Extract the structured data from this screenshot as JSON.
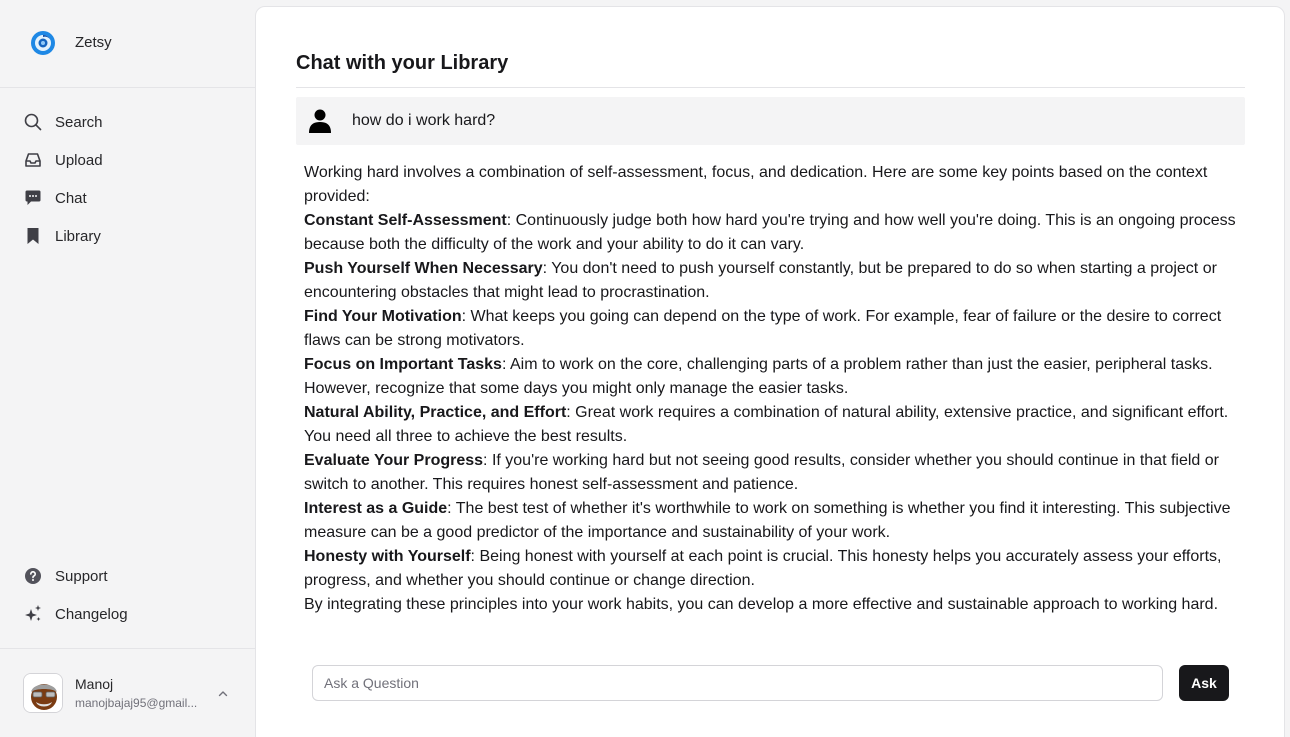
{
  "app": {
    "name": "Zetsy"
  },
  "sidebar": {
    "items": [
      {
        "label": "Search",
        "icon": "search-icon"
      },
      {
        "label": "Upload",
        "icon": "inbox-icon"
      },
      {
        "label": "Chat",
        "icon": "chat-bubble-icon"
      },
      {
        "label": "Library",
        "icon": "bookmark-icon"
      }
    ],
    "bottom_items": [
      {
        "label": "Support",
        "icon": "help-circle-icon"
      },
      {
        "label": "Changelog",
        "icon": "sparkles-icon"
      }
    ],
    "user": {
      "name": "Manoj",
      "email": "manojbajaj95@gmail..."
    }
  },
  "main": {
    "title": "Chat with your Library",
    "question": "how do i work hard?",
    "answer": {
      "intro": "Working hard involves a combination of self-assessment, focus, and dedication. Here are some key points based on the context provided:",
      "points": [
        {
          "title": "Constant Self-Assessment",
          "text": ": Continuously judge both how hard you're trying and how well you're doing. This is an ongoing process because both the difficulty of the work and your ability to do it can vary."
        },
        {
          "title": "Push Yourself When Necessary",
          "text": ": You don't need to push yourself constantly, but be prepared to do so when starting a project or encountering obstacles that might lead to procrastination."
        },
        {
          "title": "Find Your Motivation",
          "text": ": What keeps you going can depend on the type of work. For example, fear of failure or the desire to correct flaws can be strong motivators."
        },
        {
          "title": "Focus on Important Tasks",
          "text": ": Aim to work on the core, challenging parts of a problem rather than just the easier, peripheral tasks. However, recognize that some days you might only manage the easier tasks."
        },
        {
          "title": "Natural Ability, Practice, and Effort",
          "text": ": Great work requires a combination of natural ability, extensive practice, and significant effort. You need all three to achieve the best results."
        },
        {
          "title": "Evaluate Your Progress",
          "text": ": If you're working hard but not seeing good results, consider whether you should continue in that field or switch to another. This requires honest self-assessment and patience."
        },
        {
          "title": "Interest as a Guide",
          "text": ": The best test of whether it's worthwhile to work on something is whether you find it interesting. This subjective measure can be a good predictor of the importance and sustainability of your work."
        },
        {
          "title": "Honesty with Yourself",
          "text": ": Being honest with yourself at each point is crucial. This honesty helps you accurately assess your efforts, progress, and whether you should continue or change direction."
        }
      ],
      "conclusion": "By integrating these principles into your work habits, you can develop a more effective and sustainable approach to working hard."
    },
    "input": {
      "placeholder": "Ask a Question",
      "value": ""
    },
    "ask_label": "Ask"
  },
  "colors": {
    "button_bg": "#18181b",
    "sidebar_bg": "#f4f4f5",
    "logo_blue": "#1e88e5"
  }
}
